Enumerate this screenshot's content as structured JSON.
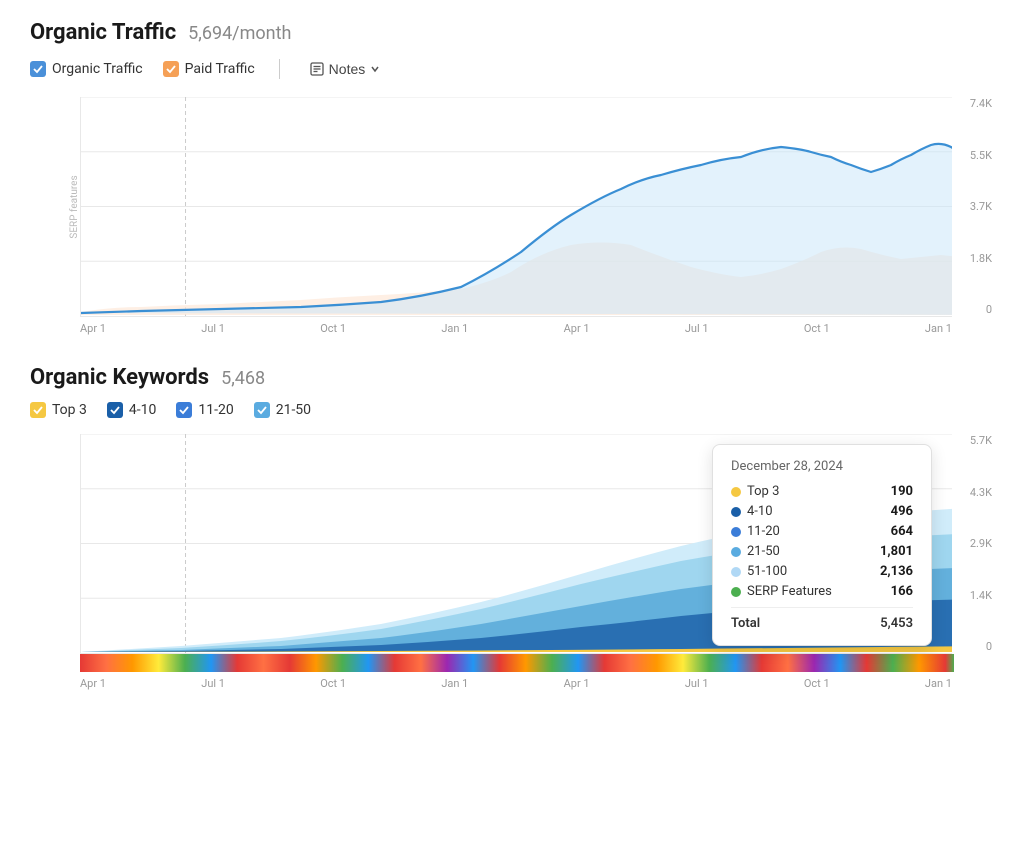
{
  "organic_traffic": {
    "title": "Organic Traffic",
    "value": "5,694/month",
    "legend": [
      {
        "id": "organic",
        "label": "Organic Traffic",
        "color": "blue",
        "checked": true
      },
      {
        "id": "paid",
        "label": "Paid Traffic",
        "color": "orange",
        "checked": true
      }
    ],
    "notes_label": "Notes",
    "y_labels": [
      "7.4K",
      "5.5K",
      "3.7K",
      "1.8K",
      "0"
    ],
    "x_labels": [
      "Apr 1",
      "Jul 1",
      "Oct 1",
      "Jan 1",
      "Apr 1",
      "Jul 1",
      "Oct 1",
      "Jan 1"
    ],
    "serp_features_label": "SERP features"
  },
  "organic_keywords": {
    "title": "Organic Keywords",
    "value": "5,468",
    "legend": [
      {
        "id": "top3",
        "label": "Top 3",
        "color": "yellow",
        "checked": true
      },
      {
        "id": "4-10",
        "label": "4-10",
        "color": "dark-blue",
        "checked": true
      },
      {
        "id": "11-20",
        "label": "11-20",
        "color": "med-blue",
        "checked": true
      },
      {
        "id": "21-50",
        "label": "21-50",
        "color": "light-blue",
        "checked": true
      }
    ],
    "y_labels": [
      "5.7K",
      "4.3K",
      "2.9K",
      "1.4K",
      "0"
    ],
    "x_labels": [
      "Apr 1",
      "Jul 1",
      "Oct 1",
      "Jan 1",
      "Apr 1",
      "Jul 1",
      "Oct 1",
      "Jan 1"
    ],
    "tooltip": {
      "date": "December 28, 2024",
      "rows": [
        {
          "label": "Top 3",
          "color": "#f5c842",
          "value": "190"
        },
        {
          "label": "4-10",
          "color": "#1a5fa8",
          "value": "496"
        },
        {
          "label": "11-20",
          "color": "#3b7dd8",
          "value": "664"
        },
        {
          "label": "21-50",
          "color": "#5aabe0",
          "value": "1,801"
        },
        {
          "label": "51-100",
          "color": "#b0d8f5",
          "value": "2,136"
        },
        {
          "label": "SERP Features",
          "color": "#4caf50",
          "value": "166"
        }
      ],
      "total_label": "Total",
      "total_value": "5,453"
    }
  }
}
